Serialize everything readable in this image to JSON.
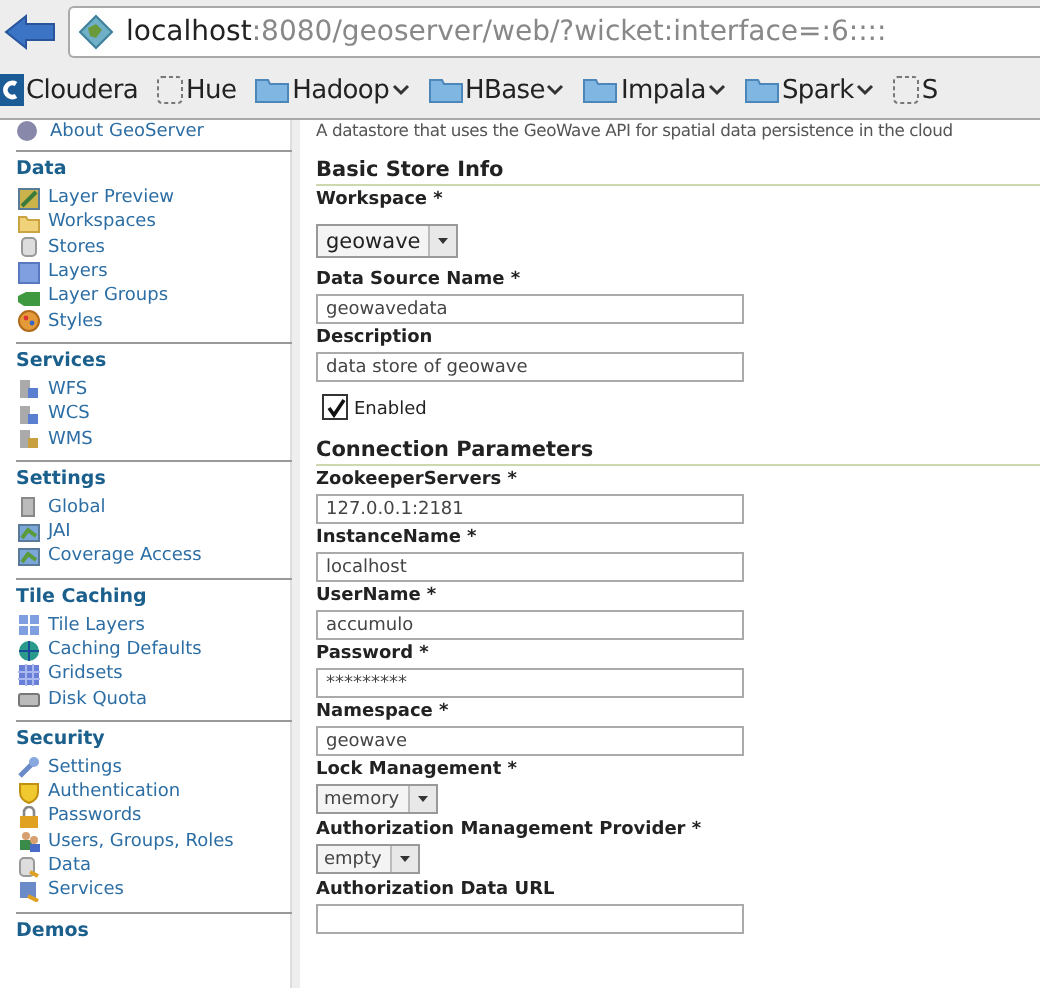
{
  "browser": {
    "url": {
      "host": "localhost",
      "path": ":8080/geoserver/web/?wicket:interface=:6::::"
    },
    "bookmarks": [
      {
        "label": "Cloudera",
        "kind": "logo",
        "menu": false
      },
      {
        "label": "Hue",
        "kind": "page",
        "menu": false
      },
      {
        "label": "Hadoop",
        "kind": "folder",
        "menu": true
      },
      {
        "label": "HBase",
        "kind": "folder",
        "menu": true
      },
      {
        "label": "Impala",
        "kind": "folder",
        "menu": true
      },
      {
        "label": "Spark",
        "kind": "folder",
        "menu": true
      },
      {
        "label": "S",
        "kind": "page",
        "menu": false
      }
    ]
  },
  "sidebar": {
    "top_item": "About GeoServer",
    "sections": [
      {
        "title": "Data",
        "items": [
          "Layer Preview",
          "Workspaces",
          "Stores",
          "Layers",
          "Layer Groups",
          "Styles"
        ]
      },
      {
        "title": "Services",
        "items": [
          "WFS",
          "WCS",
          "WMS"
        ]
      },
      {
        "title": "Settings",
        "items": [
          "Global",
          "JAI",
          "Coverage Access"
        ]
      },
      {
        "title": "Tile Caching",
        "items": [
          "Tile Layers",
          "Caching Defaults",
          "Gridsets",
          "Disk Quota"
        ]
      },
      {
        "title": "Security",
        "items": [
          "Settings",
          "Authentication",
          "Passwords",
          "Users, Groups, Roles",
          "Data",
          "Services"
        ]
      },
      {
        "title": "Demos"
      }
    ]
  },
  "form": {
    "description": "A datastore that uses the GeoWave API for spatial data persistence in the cloud",
    "sections": [
      {
        "title": "Basic Store Info",
        "fields": [
          {
            "kind": "select",
            "label": "Workspace *",
            "value": "geowave"
          },
          {
            "kind": "text",
            "label": "Data Source Name *",
            "value": "geowavedata"
          },
          {
            "kind": "text",
            "label": "Description",
            "value": "data store of geowave"
          },
          {
            "kind": "checkbox",
            "label": "Enabled",
            "checked": true
          }
        ]
      },
      {
        "title": "Connection Parameters",
        "fields": [
          {
            "kind": "text",
            "label": "ZookeeperServers *",
            "value": "127.0.0.1:2181"
          },
          {
            "kind": "text",
            "label": "InstanceName *",
            "value": "localhost"
          },
          {
            "kind": "text",
            "label": "UserName *",
            "value": "accumulo"
          },
          {
            "kind": "text",
            "label": "Password *",
            "value": "*********"
          },
          {
            "kind": "text",
            "label": "Namespace *",
            "value": "geowave"
          },
          {
            "kind": "select",
            "label": "Lock Management *",
            "value": "memory"
          },
          {
            "kind": "select",
            "label": "Authorization Management Provider *",
            "value": "empty"
          },
          {
            "kind": "text",
            "label": "Authorization Data URL"
          }
        ]
      }
    ]
  }
}
